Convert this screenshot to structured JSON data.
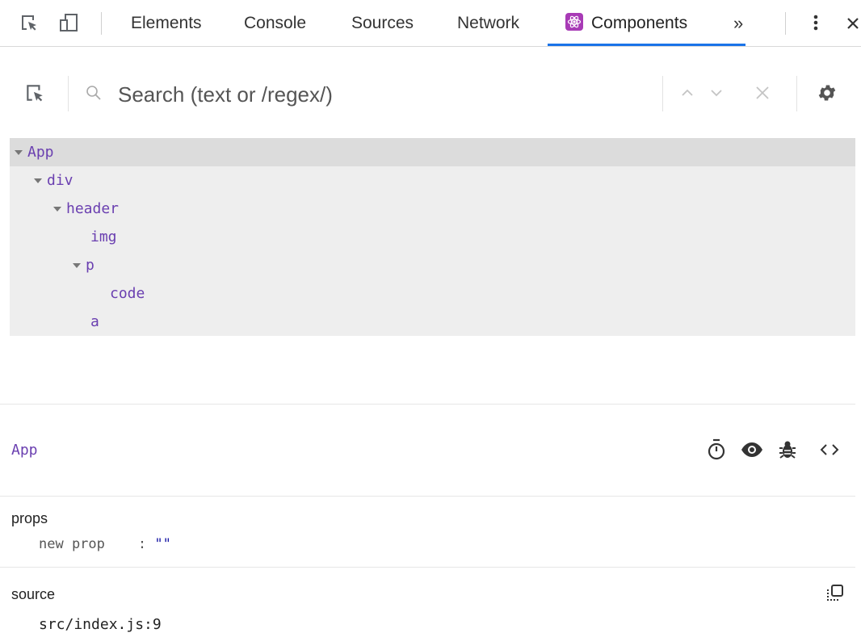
{
  "toolbar": {
    "tabs": [
      {
        "label": "Elements"
      },
      {
        "label": "Console"
      },
      {
        "label": "Sources"
      },
      {
        "label": "Network"
      },
      {
        "label": "Components",
        "active": true
      }
    ],
    "more_label": "»"
  },
  "search": {
    "placeholder": "Search (text or /regex/)"
  },
  "tree": [
    {
      "name": "App",
      "depth": 0,
      "expanded": true,
      "selected": true
    },
    {
      "name": "div",
      "depth": 1,
      "expanded": true
    },
    {
      "name": "header",
      "depth": 2,
      "expanded": true
    },
    {
      "name": "img",
      "depth": 3
    },
    {
      "name": "p",
      "depth": 3,
      "expanded": true
    },
    {
      "name": "code",
      "depth": 4
    },
    {
      "name": "a",
      "depth": 3
    }
  ],
  "inspector": {
    "component_name": "App",
    "props_title": "props",
    "props": [
      {
        "key": "new prop",
        "sep": ":",
        "value": "\"\""
      }
    ],
    "source_title": "source",
    "source_value": "src/index.js:9"
  },
  "colors": {
    "accent": "#1a73e8",
    "component": "#6a3fb0",
    "react_badge": "#a83bb6"
  }
}
